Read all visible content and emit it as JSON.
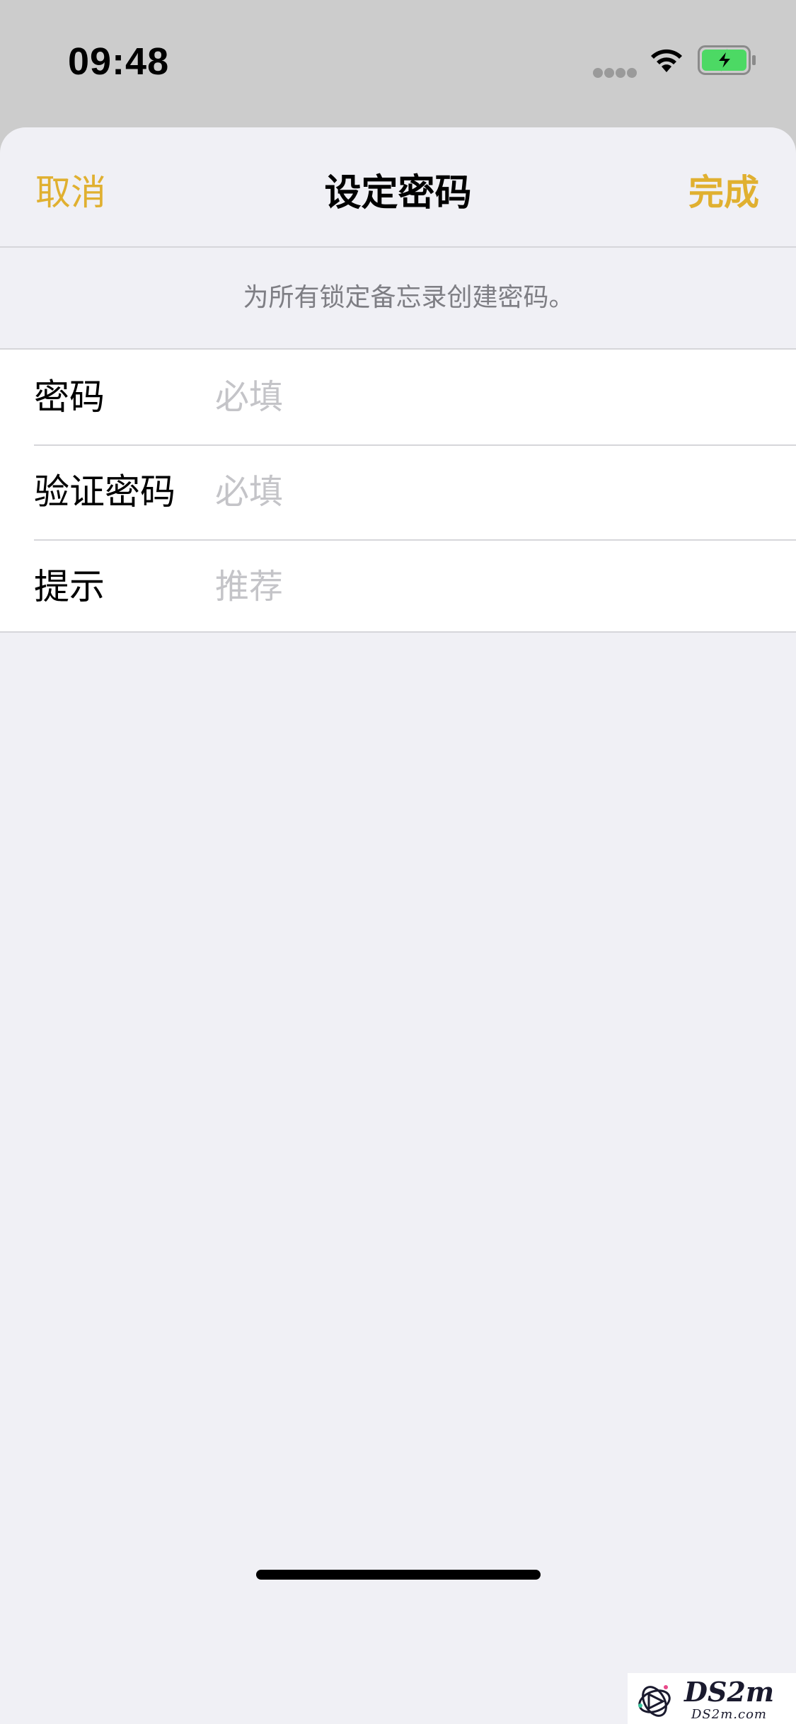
{
  "status_bar": {
    "time": "09:48",
    "icons": [
      "signal-dots-icon",
      "wifi-icon",
      "battery-charging-icon"
    ]
  },
  "nav": {
    "cancel_label": "取消",
    "title": "设定密码",
    "done_label": "完成"
  },
  "section": {
    "header": "为所有锁定备忘录创建密码。"
  },
  "form": {
    "rows": [
      {
        "label": "密码",
        "placeholder": "必填",
        "value": ""
      },
      {
        "label": "验证密码",
        "placeholder": "必填",
        "value": ""
      },
      {
        "label": "提示",
        "placeholder": "推荐",
        "value": ""
      }
    ]
  },
  "watermark": {
    "text": "DS2m",
    "sub": "DS2m.com"
  },
  "colors": {
    "accent": "#e0b030",
    "background": "#f0f0f5",
    "status_bar_bg": "#cccccc",
    "placeholder": "#c4c4c8",
    "battery": "#4cd964"
  }
}
